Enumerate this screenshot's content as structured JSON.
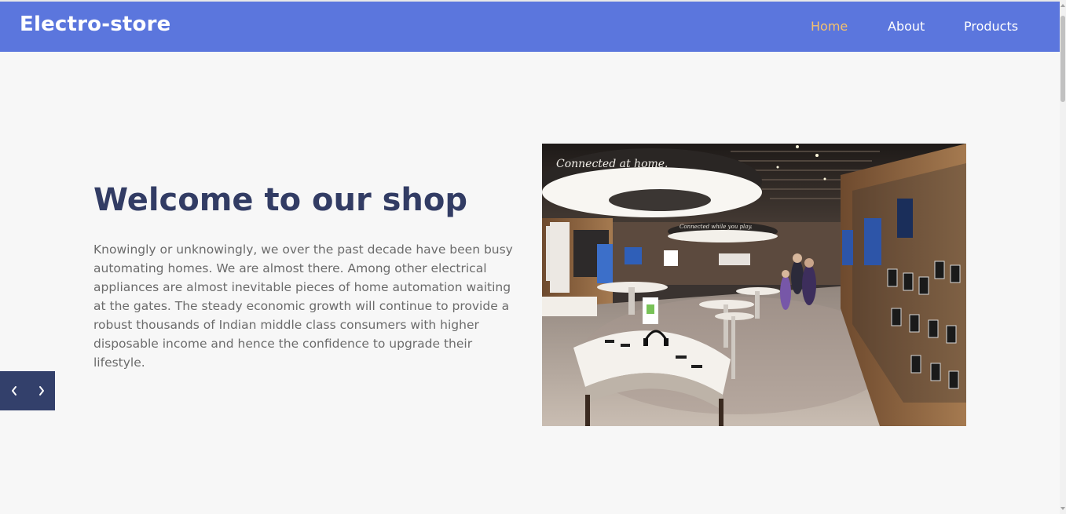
{
  "navbar": {
    "brand": "Electro-store",
    "links": [
      {
        "label": "Home",
        "active": true
      },
      {
        "label": "About",
        "active": false
      },
      {
        "label": "Products",
        "active": false
      }
    ]
  },
  "hero": {
    "title": "Welcome to our shop",
    "body": "Knowingly or unknowingly, we over the past decade have been busy automating homes. We are almost there. Among other electrical appliances are almost inevitable pieces of home automation waiting at the gates. The steady economic growth will continue to provide a robust thousands of Indian middle class consumers with higher disposable income and hence the confidence to upgrade their lifestyle.",
    "image": {
      "sign_main": "Connected at home.",
      "sign_secondary": "Connected while you play."
    }
  },
  "slider": {
    "prev_icon": "chevron-left-icon",
    "next_icon": "chevron-right-icon"
  },
  "colors": {
    "navbar": "#5b76dd",
    "active_link": "#f5c16c",
    "title": "#323c64",
    "slider_bg": "#33406b"
  }
}
